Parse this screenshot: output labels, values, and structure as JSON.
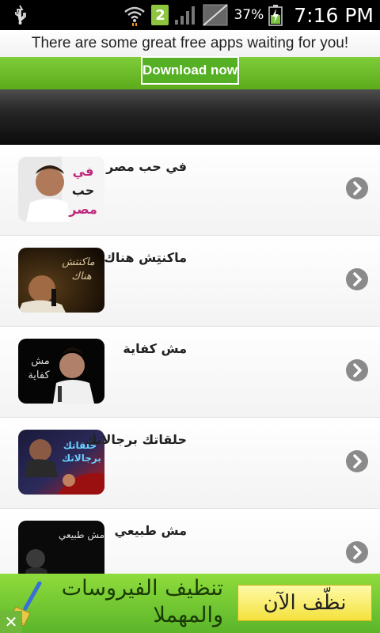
{
  "status_bar": {
    "notification_badge": "2",
    "battery_percent": "37%",
    "clock": "7:16 PM",
    "icons": [
      "usb-icon",
      "wifi-icon",
      "signal-icon",
      "no-sim-icon",
      "battery-charging-icon"
    ]
  },
  "ad_top": {
    "text": "There are some great free apps waiting for you!",
    "button_label": "Download now"
  },
  "songs": [
    {
      "title": "في حب مصر",
      "thumb_text": "في حب مصر"
    },
    {
      "title": "ماكنتِش هناك",
      "thumb_text": "ماكنتش هناك"
    },
    {
      "title": "مش كفاية",
      "thumb_text": "مش كفاية"
    },
    {
      "title": "حلقاتك برجالاتك",
      "thumb_text": "حلقاتك برجالاتك"
    },
    {
      "title": "مش طبيعي",
      "thumb_text": "مش طبيعي"
    }
  ],
  "ad_bottom": {
    "text": "تنظيف الفيروسات والمهملا",
    "button_label": "نظّف الآن",
    "close_label": "✕"
  },
  "colors": {
    "ad_green": "#5cab1a",
    "header_dark": "#0b0b0b",
    "chevron_gray": "#8a8a8a",
    "ad_button_yellow": "#f4e23c"
  }
}
